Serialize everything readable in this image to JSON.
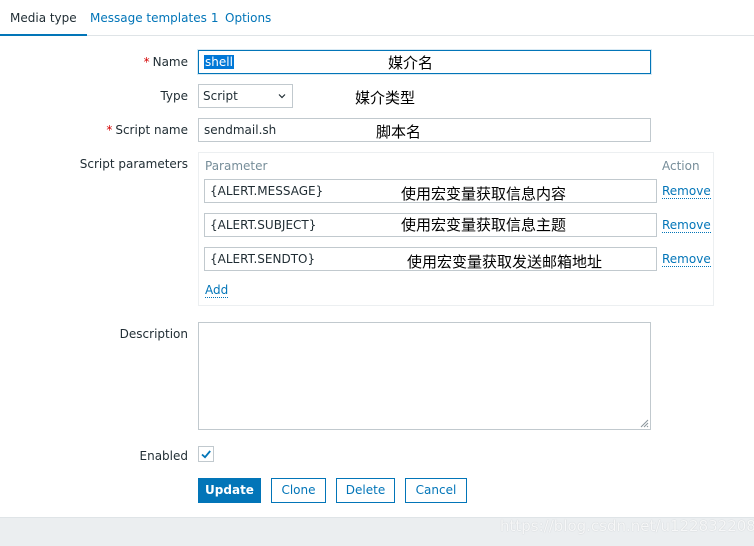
{
  "tabs": [
    {
      "label": "Media type",
      "active": true
    },
    {
      "label": "Message templates",
      "count": "1",
      "active": false
    },
    {
      "label": "Options",
      "active": false
    }
  ],
  "form": {
    "name": {
      "label": "Name",
      "required_mark": "*",
      "value": "shell",
      "annotation": "媒介名"
    },
    "type": {
      "label": "Type",
      "value": "Script",
      "annotation": "媒介类型"
    },
    "script_name": {
      "label": "Script name",
      "required_mark": "*",
      "value": "sendmail.sh",
      "annotation": "脚本名"
    },
    "script_parameters": {
      "label": "Script parameters",
      "column_parameter": "Parameter",
      "column_action": "Action",
      "rows": [
        {
          "value": "{ALERT.MESSAGE}",
          "annotation": "使用宏变量获取信息内容",
          "action": "Remove"
        },
        {
          "value": "{ALERT.SUBJECT}",
          "annotation": "使用宏变量获取信息主题",
          "action": "Remove"
        },
        {
          "value": "{ALERT.SENDTO}",
          "annotation": "使用宏变量获取发送邮箱地址",
          "action": "Remove"
        }
      ],
      "add_label": "Add"
    },
    "description": {
      "label": "Description",
      "value": ""
    },
    "enabled": {
      "label": "Enabled",
      "checked": true
    }
  },
  "buttons": {
    "update": "Update",
    "clone": "Clone",
    "delete": "Delete",
    "cancel": "Cancel"
  },
  "watermark": "https://blog.csdn.net/u1228322088",
  "colors": {
    "accent": "#0275b8",
    "required": "#d40000",
    "page_background": "#ebeef0"
  },
  "icons": {
    "type_dropdown": "chevron-down-icon",
    "enabled_check": "checkmark-icon",
    "description_resize": "resize-grip-icon"
  }
}
